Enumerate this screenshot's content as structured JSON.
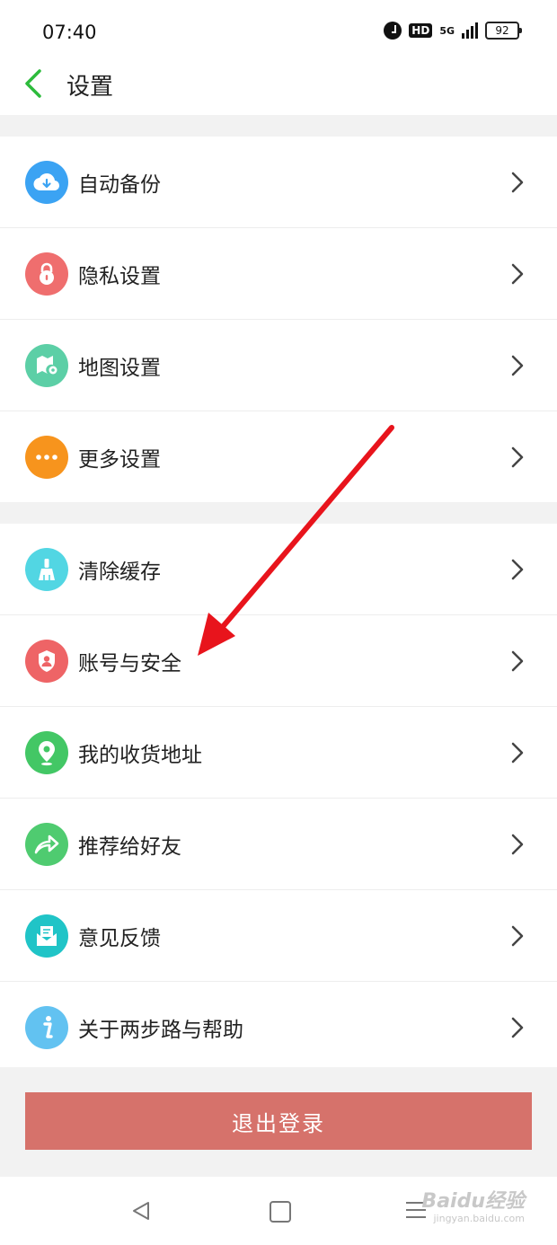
{
  "status_bar": {
    "time": "07:40",
    "hd": "HD",
    "network": "5G",
    "battery": "92"
  },
  "header": {
    "title": "设置"
  },
  "group1": [
    {
      "label": "自动备份",
      "icon": "cloud-download-icon",
      "color": "#3ba3f3"
    },
    {
      "label": "隐私设置",
      "icon": "lock-icon",
      "color": "#ef6e6e"
    },
    {
      "label": "地图设置",
      "icon": "map-settings-icon",
      "color": "#5ccfa6"
    },
    {
      "label": "更多设置",
      "icon": "more-dots-icon",
      "color": "#f7941d"
    }
  ],
  "group2": [
    {
      "label": "清除缓存",
      "icon": "broom-icon",
      "color": "#52d6e3"
    },
    {
      "label": "账号与安全",
      "icon": "shield-user-icon",
      "color": "#ee6466"
    },
    {
      "label": "我的收货地址",
      "icon": "location-pin-icon",
      "color": "#43c765"
    },
    {
      "label": "推荐给好友",
      "icon": "share-arrow-icon",
      "color": "#4fcb70"
    },
    {
      "label": "意见反馈",
      "icon": "envelope-icon",
      "color": "#20c4c7"
    },
    {
      "label": "关于两步路与帮助",
      "icon": "info-icon",
      "color": "#62c2f1"
    }
  ],
  "logout": {
    "label": "退出登录",
    "color": "#d6726b"
  },
  "watermark": {
    "brand": "Baidu经验",
    "url": "jingyan.baidu.com"
  },
  "accent_color": "#2dbb3c"
}
